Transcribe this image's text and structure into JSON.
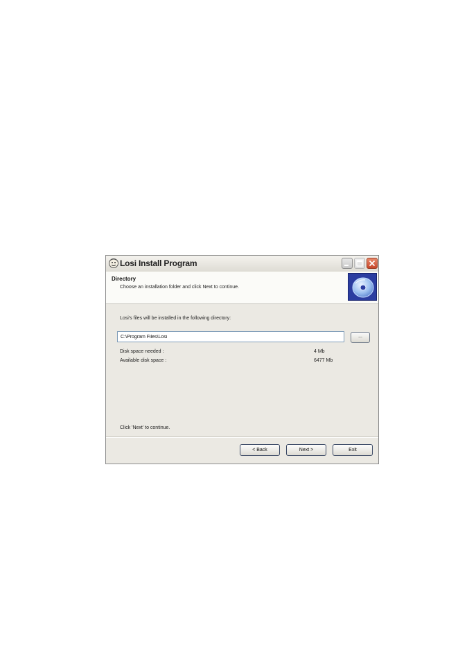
{
  "window": {
    "title": "Losi Install Program",
    "controls": [
      "minimize-icon",
      "maximize-icon",
      "close-icon"
    ]
  },
  "header": {
    "title": "Directory",
    "subtitle": "Choose an installation folder and click Next to continue.",
    "icon": "cd-disc-icon"
  },
  "main": {
    "intro": "Losi's files will be installed in the following directory:",
    "path_value": "C:\\Program Files\\Losi",
    "browse_label": "...",
    "space_needed_label": "Disk space needed :",
    "space_needed_value": "4 Mb",
    "space_available_label": "Available disk space :",
    "space_available_value": "6477 Mb",
    "footer_hint": "Click 'Next' to continue."
  },
  "buttons": {
    "back": "< Back",
    "next": "Next >",
    "exit": "Exit"
  },
  "colors": {
    "window_bg": "#ebe9e3",
    "header_bg": "#fbfbf8",
    "cd_box_bg": "#2b3da0",
    "close_btn": "#c6462b"
  }
}
